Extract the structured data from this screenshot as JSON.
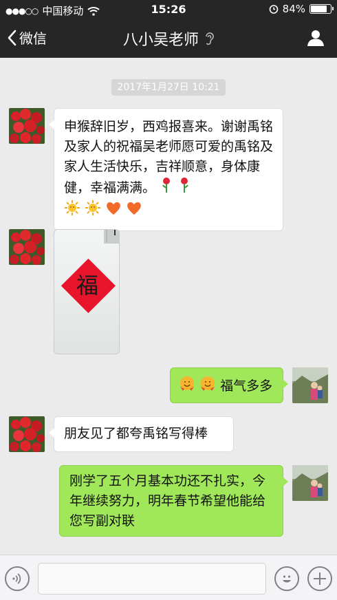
{
  "status_bar": {
    "carrier": "中国移动",
    "time": "15:26",
    "battery_text": "84%",
    "battery_level": 0.84
  },
  "nav": {
    "back_label": "微信",
    "title": "八小吴老师"
  },
  "chat": {
    "timestamp": "2017年1月27日 10:21",
    "messages": [
      {
        "from": "contact",
        "text": "申猴辞旧岁，西鸡报喜来。谢谢禹铭及家人的祝福吴老师愿可爱的禹铭及家人生活快乐，吉祥顺意，身体康健，幸福满满。"
      },
      {
        "from": "contact",
        "image_text": "福"
      },
      {
        "from": "me",
        "text": "福气多多"
      },
      {
        "from": "contact",
        "text": "朋友见了都夸禹铭写得棒"
      },
      {
        "from": "me",
        "text": "刚学了五个月基本功还不扎实，今年继续努力，明年春节希望他能给您写副对联"
      }
    ]
  },
  "colors": {
    "bar_dark": "#262626",
    "chat_bg": "#ebebeb",
    "bubble_out": "#a0e75a",
    "bubble_in": "#ffffff",
    "fu_red": "#e8142c"
  }
}
